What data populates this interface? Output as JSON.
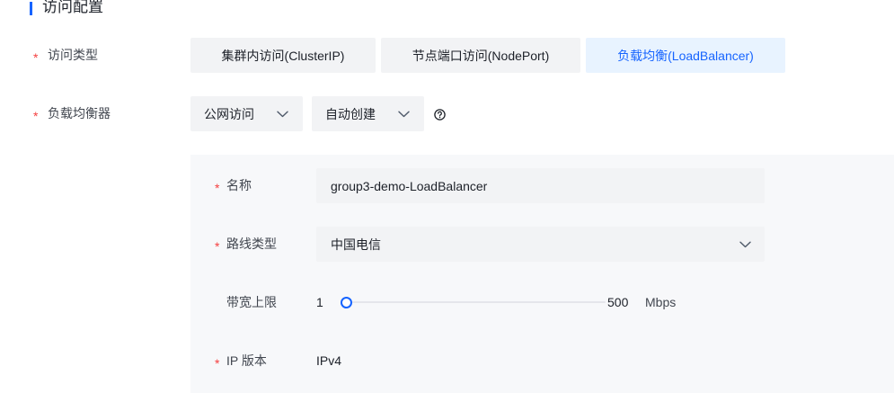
{
  "section": {
    "title": "访问配置"
  },
  "access_type": {
    "required_mark": "*",
    "label": "访问类型",
    "options": [
      {
        "label": "集群内访问(ClusterIP)",
        "selected": false
      },
      {
        "label": "节点端口访问(NodePort)",
        "selected": false
      },
      {
        "label": "负载均衡(LoadBalancer)",
        "selected": true
      }
    ]
  },
  "load_balancer": {
    "required_mark": "*",
    "label": "负载均衡器",
    "network_select": {
      "value": "公网访问",
      "icon": "chevron-down-icon"
    },
    "creation_select": {
      "value": "自动创建",
      "icon": "chevron-down-icon"
    },
    "help_icon": "question-circle-icon"
  },
  "config": {
    "name": {
      "required_mark": "*",
      "label": "名称",
      "value": "group3-demo-LoadBalancer"
    },
    "line_type": {
      "required_mark": "*",
      "label": "路线类型",
      "value": "中国电信",
      "icon": "chevron-down-icon"
    },
    "bandwidth": {
      "label": "带宽上限",
      "min_label": "1",
      "max_label": "500",
      "unit": "Mbps",
      "value": 1
    },
    "ip_version": {
      "required_mark": "*",
      "label": "IP 版本",
      "value": "IPv4"
    }
  },
  "colors": {
    "accent": "#1664ff",
    "required": "#f53f3f",
    "selected_bg": "#e8f3ff",
    "control_bg": "#f2f3f5",
    "panel_bg": "#f7f8fa"
  }
}
